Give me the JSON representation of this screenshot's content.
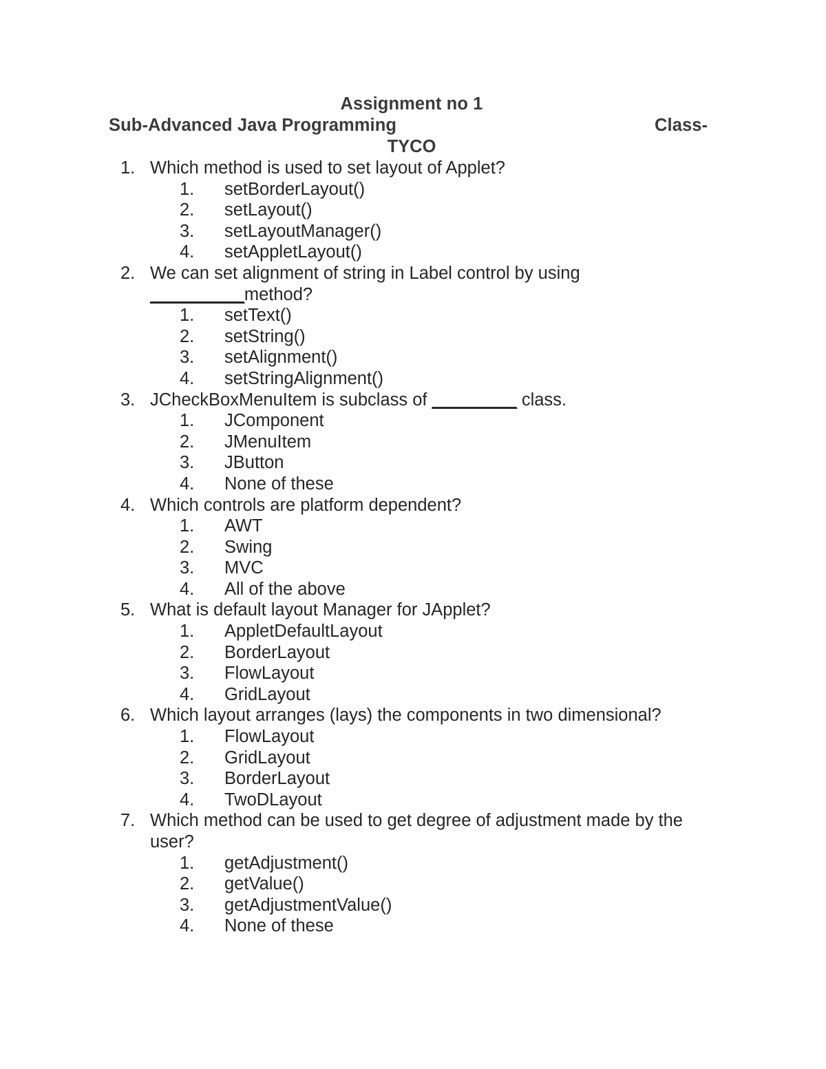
{
  "header": {
    "title": "Assignment no 1",
    "subject": "Sub-Advanced Java Programming",
    "class_label": "Class-",
    "class_value": "TYCO"
  },
  "questions": [
    {
      "number": "1.",
      "text": "Which method is used to set layout of Applet?",
      "options": [
        {
          "number": "1.",
          "text": "setBorderLayout()"
        },
        {
          "number": "2.",
          "text": "setLayout()"
        },
        {
          "number": "3.",
          "text": "setLayoutManager()"
        },
        {
          "number": "4.",
          "text": "setAppletLayout()"
        }
      ]
    },
    {
      "number": "2.",
      "text": "We can set alignment of string in Label control by using __________method?",
      "options": [
        {
          "number": "1.",
          "text": "setText()"
        },
        {
          "number": "2.",
          "text": "setString()"
        },
        {
          "number": "3.",
          "text": "setAlignment()"
        },
        {
          "number": "4.",
          "text": "setStringAlignment()"
        }
      ]
    },
    {
      "number": "3.",
      "text": "JCheckBoxMenuItem is subclass of _________ class.",
      "options": [
        {
          "number": "1.",
          "text": "JComponent"
        },
        {
          "number": "2.",
          "text": "JMenuItem"
        },
        {
          "number": "3.",
          "text": "JButton"
        },
        {
          "number": "4.",
          "text": "None of these"
        }
      ]
    },
    {
      "number": "4.",
      "text": "Which controls are platform dependent?",
      "options": [
        {
          "number": "1.",
          "text": "AWT"
        },
        {
          "number": "2.",
          "text": "Swing"
        },
        {
          "number": "3.",
          "text": "MVC"
        },
        {
          "number": "4.",
          "text": "All of the above"
        }
      ]
    },
    {
      "number": "5.",
      "text": "What is default layout Manager for JApplet?",
      "options": [
        {
          "number": "1.",
          "text": "AppletDefaultLayout"
        },
        {
          "number": "2.",
          "text": "BorderLayout"
        },
        {
          "number": "3.",
          "text": "FlowLayout"
        },
        {
          "number": "4.",
          "text": "GridLayout"
        }
      ]
    },
    {
      "number": "6.",
      "text": "Which layout arranges (lays) the components in two dimensional?",
      "options": [
        {
          "number": "1.",
          "text": "FlowLayout"
        },
        {
          "number": "2.",
          "text": "GridLayout"
        },
        {
          "number": "3.",
          "text": "BorderLayout"
        },
        {
          "number": "4.",
          "text": "TwoDLayout"
        }
      ]
    },
    {
      "number": "7.",
      "text": "Which method can be used to get degree of adjustment made by the user?",
      "options": [
        {
          "number": "1.",
          "text": "getAdjustment()"
        },
        {
          "number": "2.",
          "text": "getValue()"
        },
        {
          "number": "3.",
          "text": "getAdjustmentValue()"
        },
        {
          "number": "4.",
          "text": "None of these"
        }
      ]
    }
  ]
}
